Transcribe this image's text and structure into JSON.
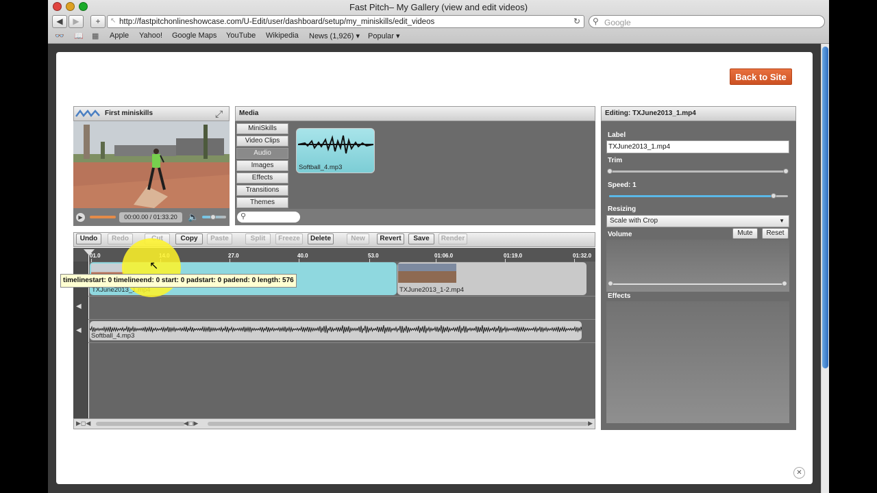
{
  "browser": {
    "window_title": "Fast Pitch– My Gallery (view and edit videos)",
    "url": "http://fastpitchonlineshowcase.com/U-Edit/user/dashboard/setup/my_miniskills/edit_videos",
    "search_placeholder": "Google",
    "bookmarks": [
      "Apple",
      "Yahoo!",
      "Google Maps",
      "YouTube",
      "Wikipedia",
      "News (1,926) ▾",
      "Popular ▾"
    ]
  },
  "page": {
    "back_to_site_label": "Back to Site"
  },
  "preview": {
    "title": "First miniskills",
    "time_display": "00:00.00 / 01:33.20"
  },
  "media": {
    "title": "Media",
    "tabs": [
      "MiniSkills",
      "Video Clips",
      "Audio",
      "Images",
      "Effects",
      "Transitions",
      "Themes"
    ],
    "selected_tab": "Audio",
    "items": [
      {
        "name": "Softball_4.mp3"
      }
    ]
  },
  "toolbar": {
    "buttons": [
      {
        "label": "Undo",
        "enabled": true
      },
      {
        "label": "Redo",
        "enabled": false
      },
      {
        "label": "Cut",
        "enabled": false
      },
      {
        "label": "Copy",
        "enabled": true
      },
      {
        "label": "Paste",
        "enabled": false
      },
      {
        "label": "Split",
        "enabled": false
      },
      {
        "label": "Freeze",
        "enabled": false
      },
      {
        "label": "Delete",
        "enabled": true
      },
      {
        "label": "New",
        "enabled": false
      },
      {
        "label": "Revert",
        "enabled": true
      },
      {
        "label": "Save",
        "enabled": true
      },
      {
        "label": "Render",
        "enabled": false
      }
    ]
  },
  "timeline": {
    "ticks": [
      "01.0",
      "14.0",
      "27.0",
      "40.0",
      "53.0",
      "01:06.0",
      "01:19.0",
      "01:32.0"
    ],
    "video_clips": [
      "TXJune2013_1.mp4",
      "TXJune2013_1-2.mp4"
    ],
    "audio_clip": "Softball_4.mp3",
    "tooltip": "timelinestart: 0 timelineend: 0 start: 0 padstart: 0 padend: 0 length: 576"
  },
  "editing": {
    "title": "Editing: TXJune2013_1.mp4",
    "label_caption": "Label",
    "label_value": "TXJune2013_1.mp4",
    "trim_caption": "Trim",
    "speed_caption": "Speed: 1",
    "speed_level": 0.92,
    "resizing_caption": "Resizing",
    "resizing_value": "Scale with Crop",
    "volume_caption": "Volume",
    "mute_label": "Mute",
    "reset_label": "Reset",
    "effects_caption": "Effects"
  },
  "colors": {
    "accent_orange": "#d9602c",
    "clip_selected": "#8fd8df",
    "panel_dark": "#6b6b6b"
  }
}
